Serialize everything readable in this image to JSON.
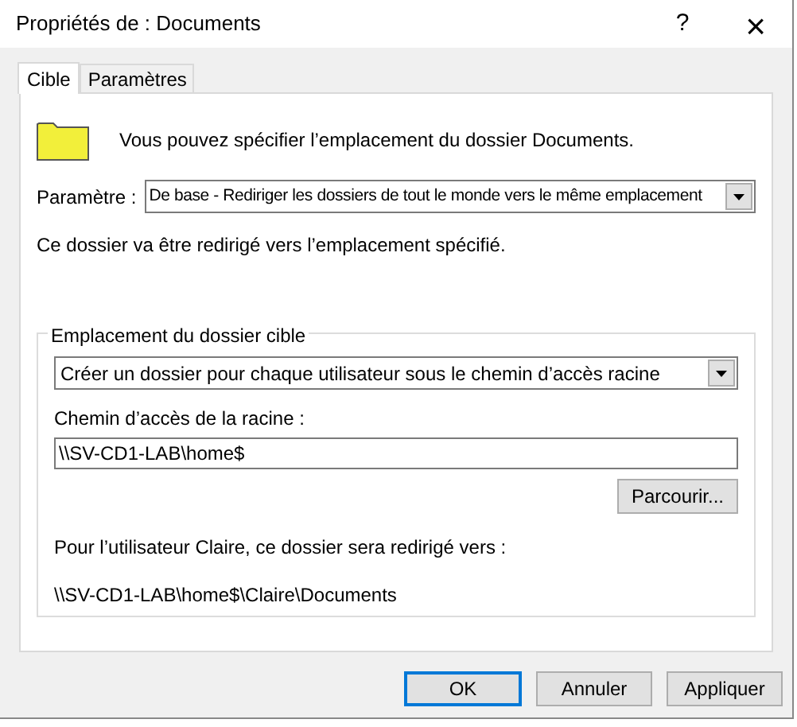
{
  "window": {
    "title": "Propriétés de : Documents",
    "help": "?",
    "close": "×"
  },
  "tabs": [
    {
      "label": "Cible",
      "selected": true
    },
    {
      "label": "Paramètres",
      "selected": false
    }
  ],
  "intro": "Vous pouvez spécifier l’emplacement du dossier Documents.",
  "setting": {
    "label": "Paramètre :",
    "value": "De base - Rediriger les dossiers de tout le monde vers le même emplacement"
  },
  "setting_note": "Ce dossier va être redirigé vers l’emplacement spécifié.",
  "target_group": {
    "title": "Emplacement du dossier cible",
    "option": "Créer un dossier pour chaque utilisateur sous le chemin d’accès racine",
    "root_label": "Chemin d’accès de la racine :",
    "root_value": "\\\\SV-CD1-LAB\\home$",
    "browse": "Parcourir...",
    "preview_label": "Pour l’utilisateur Claire, ce dossier sera redirigé vers :",
    "preview_path": "\\\\SV-CD1-LAB\\home$\\Claire\\Documents"
  },
  "buttons": [
    {
      "label": "OK",
      "default": true
    },
    {
      "label": "Annuler",
      "default": false
    },
    {
      "label": "Appliquer",
      "default": false
    }
  ]
}
